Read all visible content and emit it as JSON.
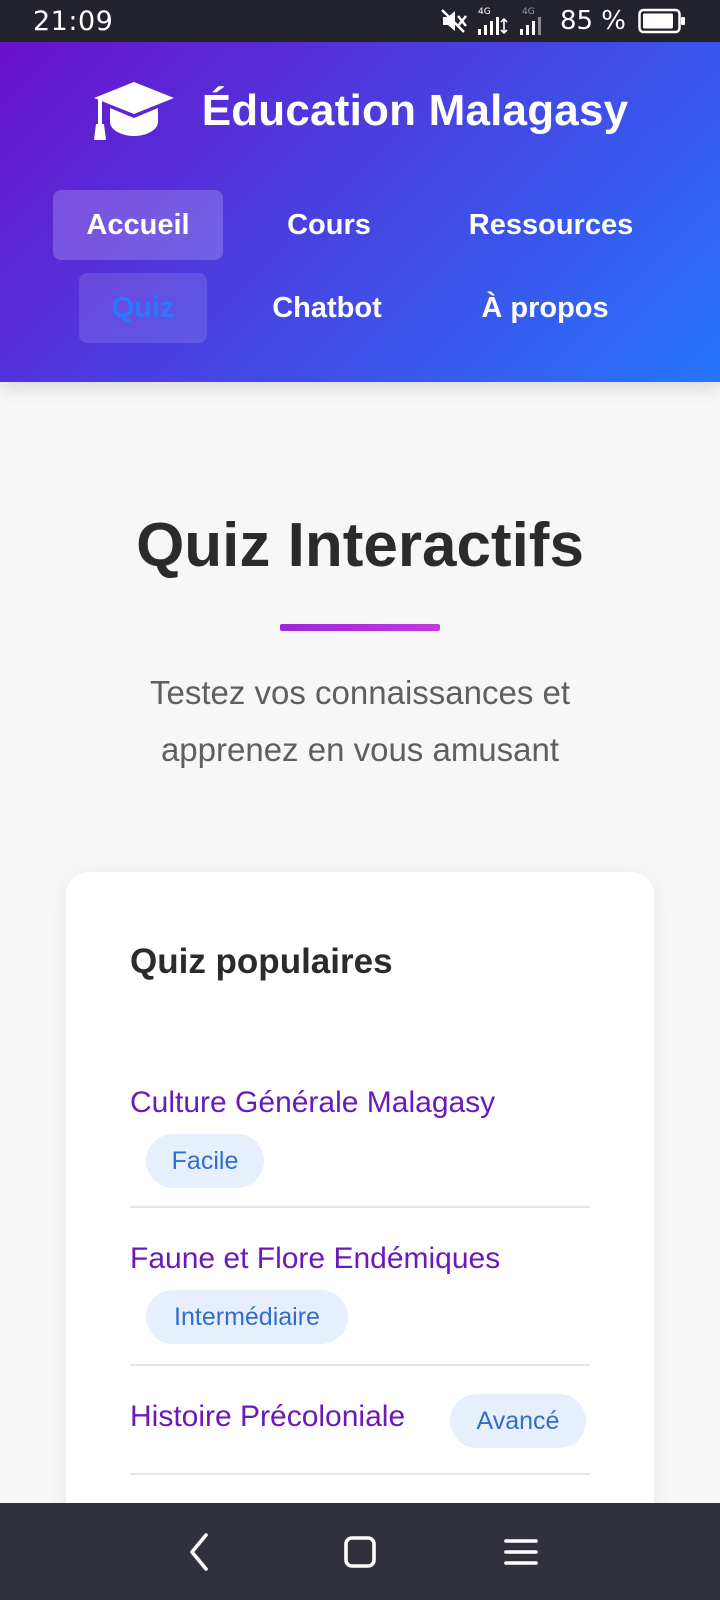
{
  "status_bar": {
    "time": "21:09",
    "network_1": "4G",
    "network_2": "4G",
    "battery_percent": "85 %",
    "icons": [
      "mute-icon",
      "signal-icon",
      "signal-icon",
      "battery-icon"
    ]
  },
  "header": {
    "brand_icon": "graduation-cap-icon",
    "title": "Éducation Malagasy",
    "nav": [
      {
        "label": "Accueil"
      },
      {
        "label": "Cours"
      },
      {
        "label": "Ressources"
      },
      {
        "label": "Quiz"
      },
      {
        "label": "Chatbot"
      },
      {
        "label": "À propos"
      }
    ],
    "colors": {
      "gradient_start": "#6a11cb",
      "gradient_end": "#2575fc",
      "active_nav_text": "#2979ff"
    }
  },
  "hero": {
    "title": "Quiz Interactifs",
    "subtitle": "Testez vos connaissances et apprenez en vous amusant",
    "underline_color": "#b02fdc"
  },
  "popular": {
    "title": "Quiz populaires",
    "items": [
      {
        "title": "Culture Générale Malagasy",
        "level": "Facile"
      },
      {
        "title": "Faune et Flore Endémiques",
        "level": "Intermédiaire"
      },
      {
        "title": "Histoire Précoloniale",
        "level": "Avancé"
      }
    ]
  },
  "system_nav": {
    "icons": [
      "back-icon",
      "home-icon",
      "menu-icon"
    ]
  }
}
